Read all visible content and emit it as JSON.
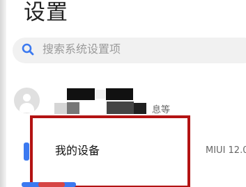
{
  "page": {
    "title": "设置"
  },
  "search": {
    "placeholder": "搜索系统设置项",
    "icon": "search-icon"
  },
  "account": {
    "caption": "息等",
    "avatar_icon": "user-avatar-icon"
  },
  "device": {
    "label": "我的设备",
    "version": "MIUI 12.0.",
    "icon": "phone-icon"
  },
  "colors": {
    "accent": "#3b79f0",
    "highlight": "#b31313",
    "search_bg": "#f1f1f1"
  }
}
